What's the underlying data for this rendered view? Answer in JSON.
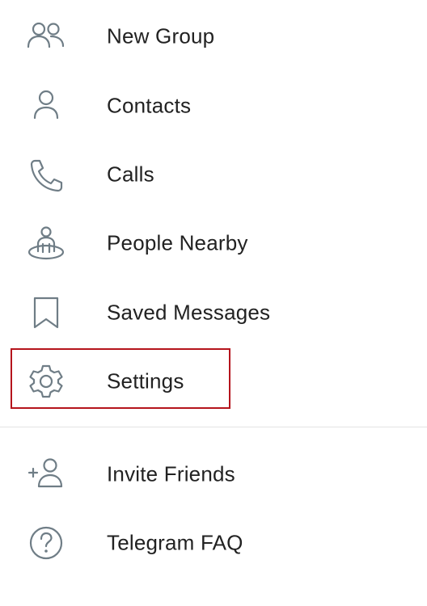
{
  "menu": {
    "items": [
      {
        "label": "New Group",
        "icon": "new-group-icon"
      },
      {
        "label": "Contacts",
        "icon": "contact-icon"
      },
      {
        "label": "Calls",
        "icon": "phone-icon"
      },
      {
        "label": "People Nearby",
        "icon": "people-nearby-icon"
      },
      {
        "label": "Saved Messages",
        "icon": "bookmark-icon"
      },
      {
        "label": "Settings",
        "icon": "gear-icon"
      },
      {
        "label": "Invite Friends",
        "icon": "add-user-icon"
      },
      {
        "label": "Telegram FAQ",
        "icon": "question-circle-icon"
      }
    ]
  },
  "colors": {
    "text": "#222222",
    "icon": "#6f7d86",
    "divider": "#e3e3e3",
    "highlight_border": "#b5141c"
  }
}
